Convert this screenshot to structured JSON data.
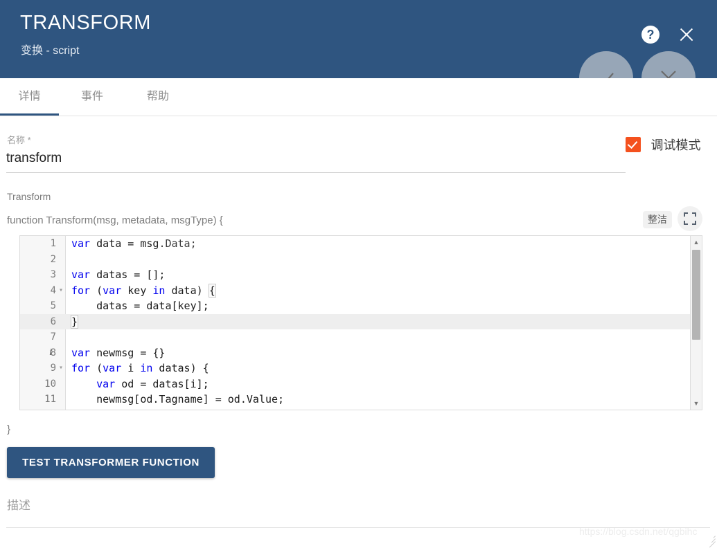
{
  "header": {
    "title": "TRANSFORM",
    "subtitle": "变换 - script",
    "help_icon_glyph": "?",
    "icons": {
      "help": "help-icon",
      "close": "close-icon",
      "accept": "check-icon",
      "reject": "cross-icon"
    },
    "background_color": "#2f5580"
  },
  "tabs": [
    {
      "label": "详情",
      "active": true
    },
    {
      "label": "事件",
      "active": false
    },
    {
      "label": "帮助",
      "active": false
    }
  ],
  "name_field": {
    "label": "名称 *",
    "value": "transform"
  },
  "debug": {
    "label": "调试模式",
    "checked": true,
    "accent_color": "#f4511e"
  },
  "script": {
    "section_title": "Transform",
    "signature": "function Transform(msg, metadata, msgType) {",
    "closing_brace": "}",
    "toolbar": {
      "tidy_label": "整洁",
      "expand_icon": "fullscreen-icon"
    },
    "lines": [
      {
        "num": "1",
        "fold": false,
        "lint": "",
        "active": false,
        "tokens": [
          {
            "t": "var",
            "c": "kw"
          },
          {
            "t": " data = msg",
            "c": ""
          },
          {
            "t": ".Data;",
            "c": "prop"
          }
        ]
      },
      {
        "num": "2",
        "fold": false,
        "lint": "",
        "active": false,
        "tokens": []
      },
      {
        "num": "3",
        "fold": false,
        "lint": "",
        "active": false,
        "tokens": [
          {
            "t": "var",
            "c": "kw"
          },
          {
            "t": " datas = [];",
            "c": ""
          }
        ]
      },
      {
        "num": "4",
        "fold": true,
        "lint": "",
        "active": false,
        "tokens": [
          {
            "t": "for",
            "c": "kw"
          },
          {
            "t": " (",
            "c": ""
          },
          {
            "t": "var",
            "c": "kw"
          },
          {
            "t": " key ",
            "c": ""
          },
          {
            "t": "in",
            "c": "kw"
          },
          {
            "t": " data) ",
            "c": ""
          },
          {
            "t": "{",
            "c": "brk"
          }
        ]
      },
      {
        "num": "5",
        "fold": false,
        "lint": "",
        "active": false,
        "tokens": [
          {
            "t": "    datas = data[key];",
            "c": ""
          }
        ]
      },
      {
        "num": "6",
        "fold": false,
        "lint": "",
        "active": true,
        "tokens": [
          {
            "t": "}",
            "c": "brk"
          }
        ]
      },
      {
        "num": "7",
        "fold": false,
        "lint": "",
        "active": false,
        "tokens": []
      },
      {
        "num": "8",
        "fold": false,
        "lint": "i",
        "active": false,
        "tokens": [
          {
            "t": "var",
            "c": "kw"
          },
          {
            "t": " newmsg = {}",
            "c": ""
          }
        ]
      },
      {
        "num": "9",
        "fold": true,
        "lint": "",
        "active": false,
        "tokens": [
          {
            "t": "for",
            "c": "kw"
          },
          {
            "t": " (",
            "c": ""
          },
          {
            "t": "var",
            "c": "kw"
          },
          {
            "t": " i ",
            "c": ""
          },
          {
            "t": "in",
            "c": "kw"
          },
          {
            "t": " datas) {",
            "c": ""
          }
        ]
      },
      {
        "num": "10",
        "fold": false,
        "lint": "",
        "active": false,
        "tokens": [
          {
            "t": "    ",
            "c": ""
          },
          {
            "t": "var",
            "c": "kw"
          },
          {
            "t": " od = datas[i];",
            "c": ""
          }
        ]
      },
      {
        "num": "11",
        "fold": false,
        "lint": "",
        "active": false,
        "tokens": [
          {
            "t": "    newmsg[od.Tagname] = od.Value;",
            "c": ""
          }
        ]
      }
    ],
    "scrollbar": {
      "up_glyph": "▲",
      "down_glyph": "▼"
    }
  },
  "test_button": {
    "label": "TEST TRANSFORMER FUNCTION"
  },
  "description": {
    "placeholder": "描述"
  },
  "watermark": {
    "text": "https://blog.csdn.net/qgbihc"
  }
}
